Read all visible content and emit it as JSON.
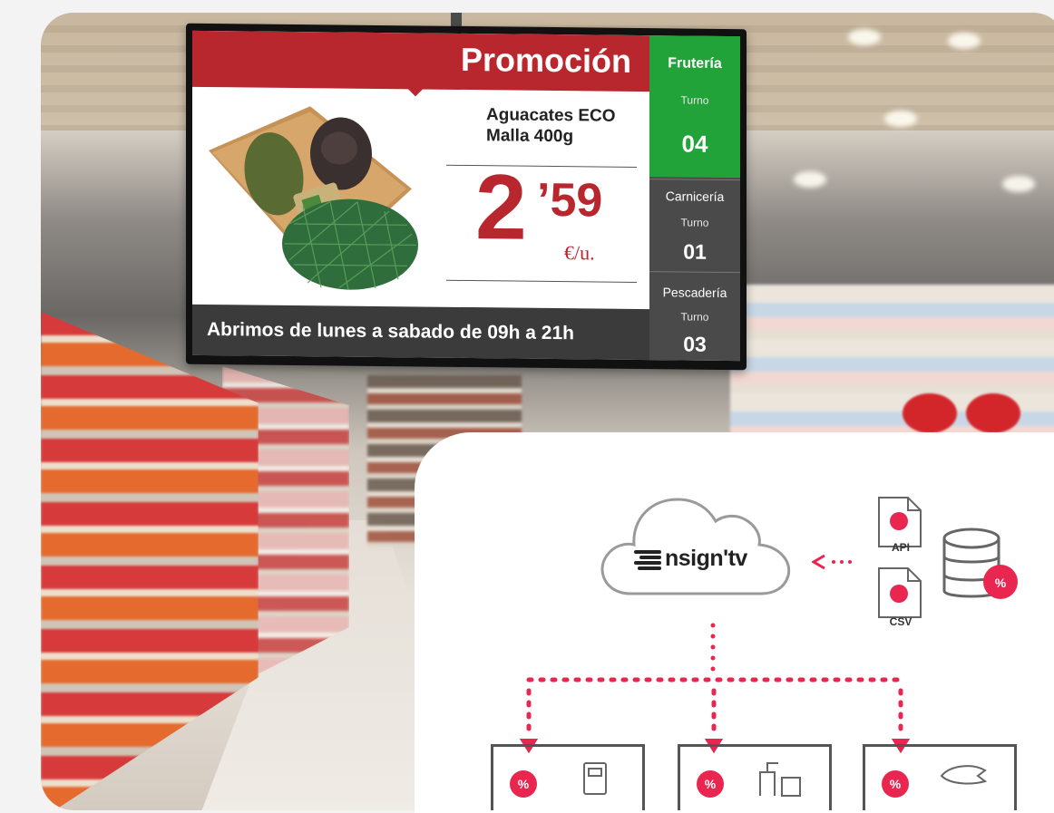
{
  "sign": {
    "promo_title": "Promoción",
    "product_name": "Aguacates ECO\nMalla 400g",
    "price_integer": "2",
    "price_decimal": "’59",
    "price_unit": "€/u.",
    "hours": "Abrimos de lunes a sabado de 09h a 21h",
    "turns": [
      {
        "department": "Frutería",
        "label": "Turno",
        "number": "04"
      },
      {
        "department": "Carnicería",
        "label": "Turno",
        "number": "01"
      },
      {
        "department": "Pescadería",
        "label": "Turno",
        "number": "03"
      }
    ]
  },
  "diagram": {
    "brand": "nsign'tv",
    "sources": [
      "API",
      "CSV"
    ],
    "badge_symbol": "%"
  },
  "colors": {
    "promo_red": "#b8262e",
    "turn_green": "#22a33a",
    "accent_pink": "#e8264f"
  }
}
